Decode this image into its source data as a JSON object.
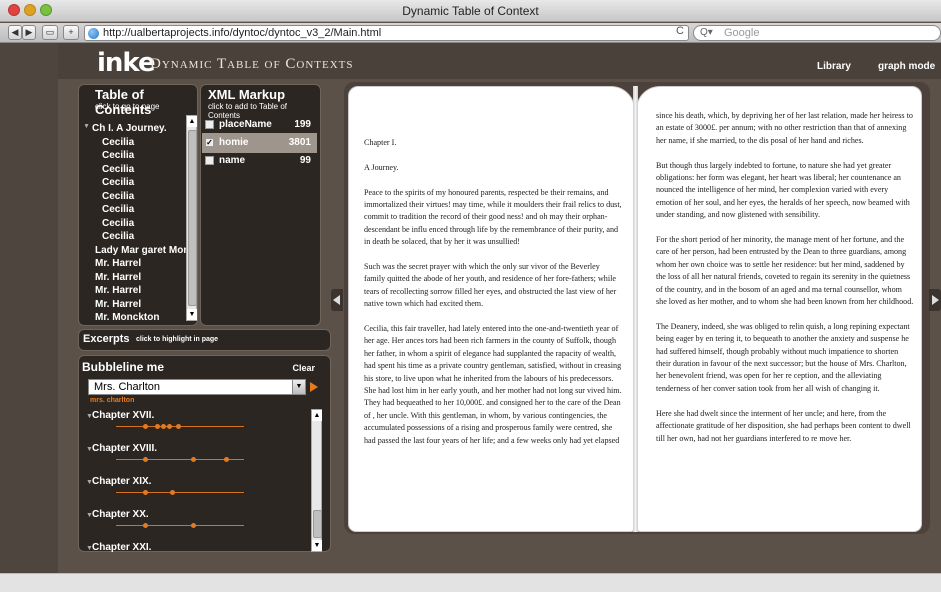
{
  "window": {
    "title": "Dynamic Table of Context"
  },
  "browser": {
    "url": "http://ualbertaprojects.info/dyntoc/dyntoc_v3_2/Main.html",
    "search_placeholder": "Google",
    "reload_glyph": "C",
    "back_glyph": "◀",
    "forward_glyph": "▶",
    "add_glyph": "+"
  },
  "app": {
    "logo": "inke",
    "title": "Dynamic Table of Contexts",
    "nav": {
      "library": "Library",
      "graph_mode": "graph mode"
    }
  },
  "toc": {
    "title": "Table of Contents",
    "subtitle": "click to go to page",
    "items": [
      "Ch I. A Journey.",
      "Cecilia",
      "Cecilia",
      "Cecilia",
      "Cecilia",
      "Cecilia",
      "Cecilia",
      "Cecilia",
      "Cecilia",
      "Lady Mar garet Monck",
      "Mr. Harrel",
      "Mr. Harrel",
      "Mr. Harrel",
      "Mr. Harrel",
      "Mr. Monckton"
    ]
  },
  "xml": {
    "title": "XML Markup",
    "subtitle": "click to add to Table of Contents",
    "rows": [
      {
        "name": "placeName",
        "count": "199",
        "checked": ""
      },
      {
        "name": "homie",
        "count": "3801",
        "checked": "✓"
      },
      {
        "name": "name",
        "count": "99",
        "checked": ""
      }
    ]
  },
  "excerpts": {
    "title": "Excerpts",
    "subtitle": "click to highlight in page"
  },
  "bubbleline": {
    "title": "Bubbleline me",
    "clear": "Clear",
    "selected": "Mrs. Charlton",
    "current": "mrs. charlton",
    "chapters": [
      {
        "label": "Chapter XVII.",
        "dots": [
          0.18,
          0.26,
          0.3,
          0.34,
          0.4
        ]
      },
      {
        "label": "Chapter XVIII.",
        "dots": [
          0.18,
          0.5,
          0.72
        ]
      },
      {
        "label": "Chapter XIX.",
        "dots": [
          0.18,
          0.36
        ]
      },
      {
        "label": "Chapter XX.",
        "dots": [
          0.18,
          0.5
        ]
      },
      {
        "label": "Chapter XXI.",
        "dots": []
      }
    ]
  },
  "book": {
    "left_page": [
      "Chapter I.",
      "A Journey.",
      "Peace to the spirits of my honoured parents, respected be their remains, and immortalized their virtues! may time, while it moulders their frail relics to dust, commit to tradition the record of their good ness! and oh may their orphan-descendant be influ enced through life by the remembrance of their purity, and in death be solaced, that by her it was unsullied!",
      "Such was the secret prayer with which the only sur vivor of the Beverley family quitted the abode of her youth, and residence of her fore-fathers; while tears of recollecting sorrow filled her eyes, and obstructed the last view of her native town which had excited them.",
      "Cecilia, this fair traveller, had lately entered into the one-and-twentieth year of her age. Her ances tors had been rich farmers in the county of Suffolk, though her father, in whom a spirit of elegance had supplanted the rapacity of wealth, had spent his time as a private country gentleman, satisfied, without in creasing his store, to live upon what he inherited from the labours of his predecessors. She had lost him in her early youth, and her mother had not long sur vived him. They had bequeathed to her 10,000£. and consigned her to the care of the Dean of , her uncle. With this gentleman, in whom, by various contingencies, the accumulated possessions of a rising and prosperous family were centred, she had passed the last four years of her life; and a few weeks only had yet elapsed"
    ],
    "right_page": [
      "since his death, which, by depriving her of her last relation, made her heiress to an estate of 3000£. per annum; with no other restriction than that of annexing her name, if she married, to the dis posal of her hand and riches.",
      "But though thus largely indebted to fortune, to nature she had yet greater obligations: her form was elegant, her heart was liberal; her countenance an nounced the intelligence of her mind, her complexion varied with every emotion of her soul, and her eyes, the heralds of her speech, now beamed with under standing, and now glistened with sensibility.",
      "For the short period of her minority, the manage ment of her fortune, and the care of her person, had been entrusted by the Dean to three guardians, among whom her own choice was to settle her residence: but her mind, saddened by the loss of all her natural friends, coveted to regain its serenity in the quietness of the country, and in the bosom of an aged and ma ternal counsellor, whom she loved as her mother, and to whom she had been known from her childhood.",
      "The Deanery, indeed, she was obliged to relin quish, a long repining expectant being eager by en tering it, to bequeath to another the anxiety and suspense he had suffered himself, though probably without much impatience to shorten their duration in favour of the next successor; but the house of Mrs. Charlton, her benevolent friend, was open for her re ception, and the alleviating tenderness of her conver sation took from her all wish of changing it.",
      "Here she had dwelt since the interment of her uncle; and here, from the affectionate gratitude of her disposition, she had perhaps been content to dwell till her own, had not her guardians interfered to re move her."
    ]
  },
  "colors": {
    "accent": "#e87a1e",
    "panel": "#2c2622",
    "background": "#5c5149"
  }
}
